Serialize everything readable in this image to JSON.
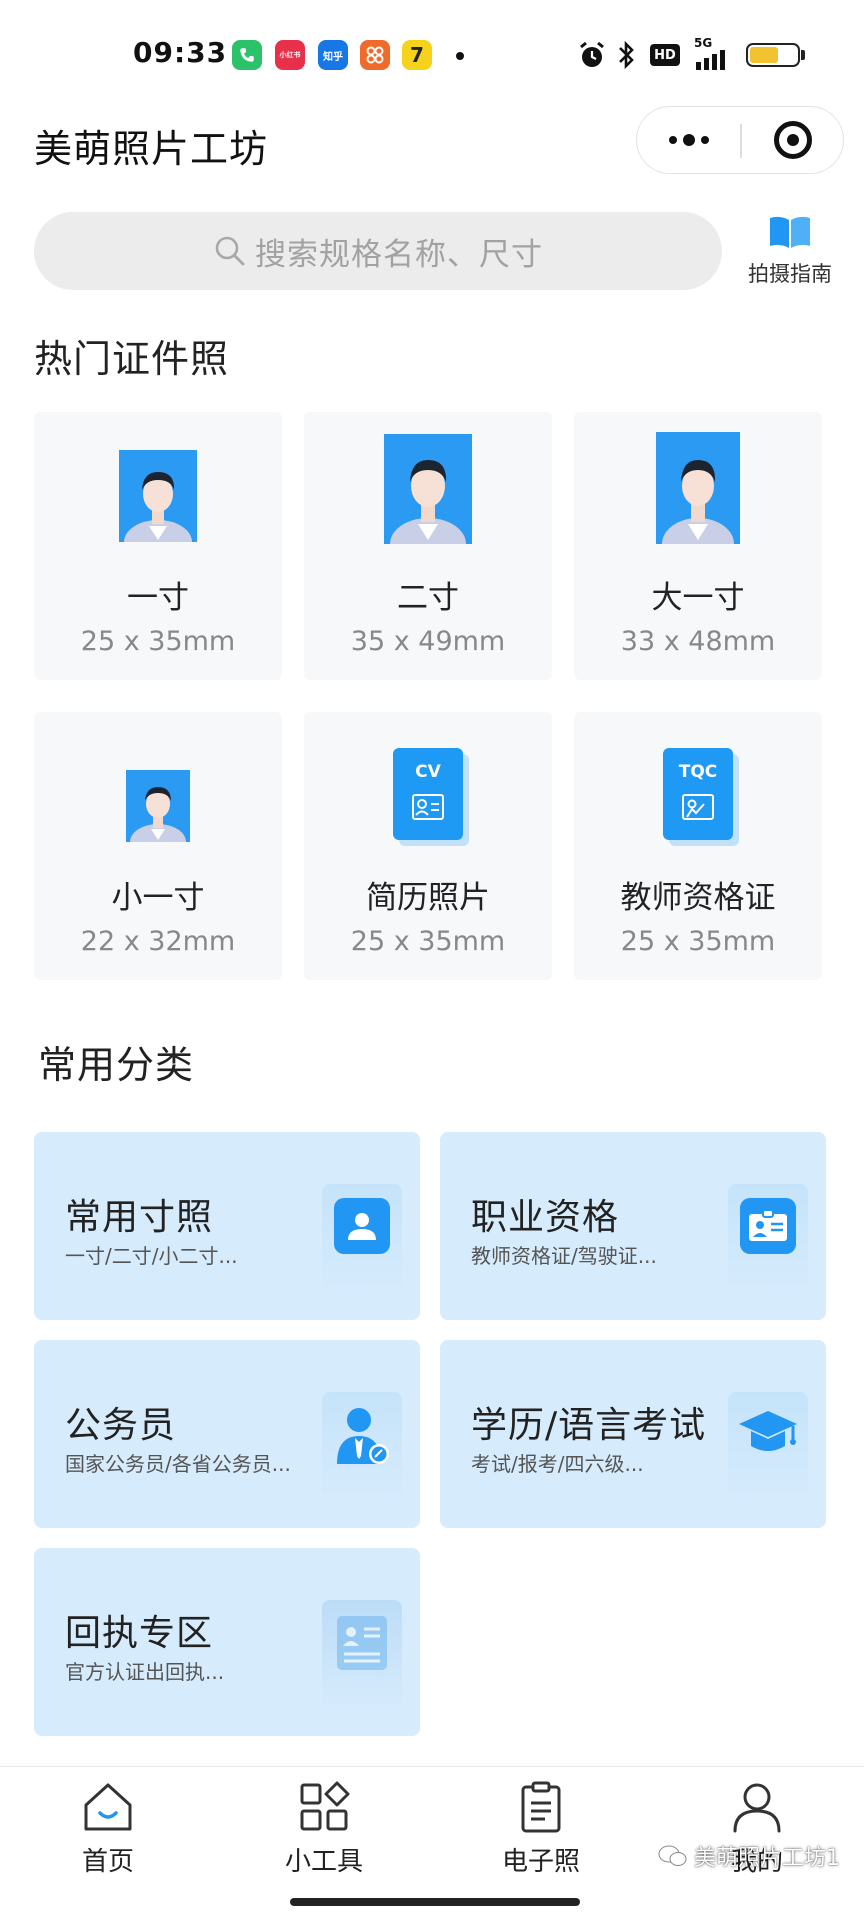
{
  "status_bar": {
    "time": "09:33",
    "apps": [
      {
        "name": "phone-app",
        "color": "#2bc26a",
        "label": ""
      },
      {
        "name": "xiaohongshu-app",
        "color": "#e8304a",
        "label": "小红书"
      },
      {
        "name": "zhihu-app",
        "color": "#1677e5",
        "label": "知乎"
      },
      {
        "name": "app-orange",
        "color": "#f06a2a",
        "label": ""
      },
      {
        "name": "app-yellow",
        "color": "#f5d31c",
        "label": "7"
      }
    ],
    "network": "5G",
    "hd": "HD"
  },
  "header": {
    "title": "美萌照片工坊"
  },
  "search": {
    "placeholder": "搜索规格名称、尺寸"
  },
  "guide": {
    "label": "拍摄指南"
  },
  "hot": {
    "title": "热门证件照",
    "items": [
      {
        "name": "一寸",
        "size": "25 x 35mm",
        "icon": "portrait-photo"
      },
      {
        "name": "二寸",
        "size": "35 x 49mm",
        "icon": "portrait-photo"
      },
      {
        "name": "大一寸",
        "size": "33 x 48mm",
        "icon": "portrait-photo"
      },
      {
        "name": "小一寸",
        "size": "22 x 32mm",
        "icon": "portrait-photo"
      },
      {
        "name": "简历照片",
        "size": "25 x 35mm",
        "icon": "cv-card",
        "badge": "CV"
      },
      {
        "name": "教师资格证",
        "size": "25 x 35mm",
        "icon": "tqc-card",
        "badge": "TQC"
      }
    ]
  },
  "categories": {
    "title": "常用分类",
    "items": [
      {
        "title": "常用寸照",
        "sub": "一寸/二寸/小二寸...",
        "icon": "user-icon"
      },
      {
        "title": "职业资格",
        "sub": "教师资格证/驾驶证...",
        "icon": "id-card-icon"
      },
      {
        "title": "公务员",
        "sub": "国家公务员/各省公务员...",
        "icon": "civil-servant-icon"
      },
      {
        "title": "学历/语言考试",
        "sub": "考试/报考/四六级...",
        "icon": "graduation-cap-icon"
      },
      {
        "title": "回执专区",
        "sub": "官方认证出回执...",
        "icon": "receipt-icon"
      }
    ]
  },
  "tabbar": {
    "items": [
      {
        "label": "首页",
        "icon": "home-icon",
        "active": true
      },
      {
        "label": "小工具",
        "icon": "grid-icon",
        "active": false
      },
      {
        "label": "电子照",
        "icon": "clipboard-icon",
        "active": false
      },
      {
        "label": "我的",
        "icon": "profile-icon",
        "active": false
      }
    ]
  },
  "watermark": {
    "text": "美萌照片工坊1"
  },
  "colors": {
    "accent": "#2196f3",
    "category_bg": "#d6ebfc",
    "card_bg": "#f7f8fa"
  }
}
